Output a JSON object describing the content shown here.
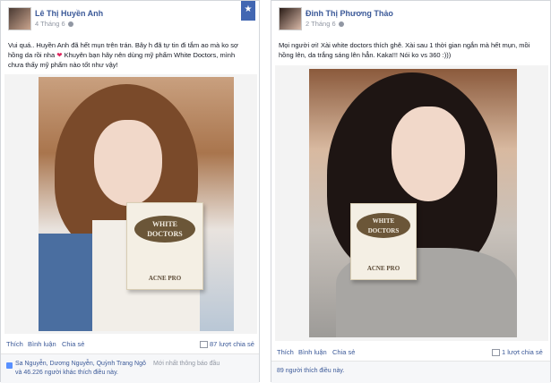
{
  "post1": {
    "name": "Lê Thị Huyền Anh",
    "time": "4 Tháng 6",
    "status": "Vui quá.. Huyền Anh đã hết mụn trên trán. Bây h đã tự tin đi tắm ao mà ko sợ hồng da rồi nha ",
    "status_heart": "❤",
    "status_tail": " Khuyên bạn hãy nên dùng mỹ phẩm White Doctors, mình chưa thấy mỹ phẩm nào tốt như vậy!",
    "box_logo": "WHITE DOCTORS",
    "box_label": "ACNE PRO",
    "actions": [
      "Thích",
      "Bình luận",
      "Chia sẻ"
    ],
    "shares": "87 lượt chia sẻ",
    "likes_text": "Sa Nguyễn, Dương Nguyễn, Quỳnh Trang Ngô và 46.226 người khác thích điều này.",
    "likes_more": "Mới nhất thông báo đầu"
  },
  "post2": {
    "name": "Đinh Thị Phương Thảo",
    "time": "2 Tháng 6",
    "status": "Mọi người ơi! Xài white doctors thích ghê. Xài sau 1 thời gian ngắn mà hết mụn, mồi hồng lên, da trắng sáng lên hẳn. Kaka!!! Nói ko vs 360 :)))",
    "box_logo": "WHITE DOCTORS",
    "box_label": "ACNE PRO",
    "actions": [
      "Thích",
      "Bình luận",
      "Chia sẻ"
    ],
    "shares": "1 lượt chia sẻ",
    "likes_count": "89 người thích điều này."
  },
  "colors": {
    "link": "#3b5998",
    "meta": "#9197a3",
    "badge": "#4267b2"
  },
  "icons": [
    "star-icon",
    "globe-icon",
    "share-icon",
    "like-thumb-icon"
  ]
}
